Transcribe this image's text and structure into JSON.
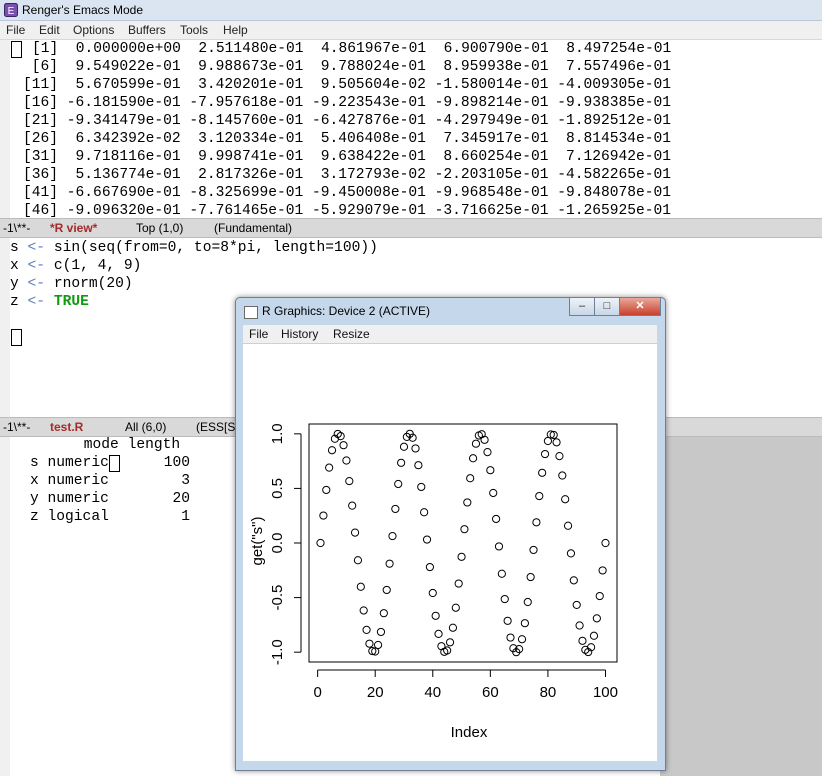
{
  "emacs": {
    "title": "Renger's Emacs Mode",
    "menu": [
      "File",
      "Edit",
      "Options",
      "Buffers",
      "Tools",
      "Help"
    ]
  },
  "output_lines": [
    "[1]  0.000000e+00  2.511480e-01  4.861967e-01  6.900790e-01  8.497254e-01",
    " [6]  9.549022e-01  9.988673e-01  9.788024e-01  8.959938e-01  7.557496e-01",
    "[11]  5.670599e-01  3.420201e-01  9.505604e-02 -1.580014e-01 -4.009305e-01",
    "[16] -6.181590e-01 -7.957618e-01 -9.223543e-01 -9.898214e-01 -9.938385e-01",
    "[21] -9.341479e-01 -8.145760e-01 -6.427876e-01 -4.297949e-01 -1.892512e-01",
    "[26]  6.342392e-02  3.120334e-01  5.406408e-01  7.345917e-01  8.814534e-01",
    "[31]  9.718116e-01  9.998741e-01  9.638422e-01  8.660254e-01  7.126942e-01",
    "[36]  5.136774e-01  2.817326e-01  3.172793e-02 -2.203105e-01 -4.582265e-01",
    "[41] -6.667690e-01 -8.325699e-01 -9.450008e-01 -9.968548e-01 -9.848078e-01",
    "[46] -9.096320e-01 -7.761465e-01 -5.929079e-01 -3.716625e-01 -1.265925e-01"
  ],
  "modeline_rview": {
    "status": "-1\\**-",
    "buffer": "*R view*",
    "position": "Top (1,0)",
    "mode": "(Fundamental)"
  },
  "rview_lines": [
    {
      "var": "s",
      "arrow": "<-",
      "rest": "sin(seq(from=0, to=8*pi, length=100))"
    },
    {
      "var": "x",
      "arrow": "<-",
      "rest": "c(1, 4, 9)"
    },
    {
      "var": "y",
      "arrow": "<-",
      "rest": "rnorm(20)"
    },
    {
      "var": "z",
      "arrow": "<-",
      "rest": "TRUE"
    }
  ],
  "modeline_test": {
    "status": "-1\\**-",
    "buffer": "test.R",
    "position": "All (6,0)",
    "mode": "(ESS[S"
  },
  "table": {
    "header": "     mode length",
    "rows": [
      {
        "name": "s",
        "mode": "numeric",
        "length": "100"
      },
      {
        "name": "x",
        "mode": "numeric",
        "length": "3"
      },
      {
        "name": "y",
        "mode": "numeric",
        "length": "20"
      },
      {
        "name": "z",
        "mode": "logical",
        "length": "1"
      }
    ]
  },
  "rgraphics": {
    "title": "R Graphics: Device 2 (ACTIVE)",
    "menu": [
      "File",
      "History",
      "Resize"
    ],
    "buttons": {
      "minimize": "–",
      "maximize": "□",
      "close": "✕"
    }
  },
  "chart_data": {
    "type": "scatter",
    "xlabel": "Index",
    "ylabel": "get(\"s\")",
    "xlim": [
      0,
      100
    ],
    "ylim": [
      -1.0,
      1.0
    ],
    "xticks": [
      0,
      20,
      40,
      60,
      80,
      100
    ],
    "yticks": [
      -1.0,
      -0.5,
      0.0,
      0.5,
      1.0
    ],
    "ytick_labels": [
      "-1.0",
      "-0.5",
      "0.0",
      "0.5",
      "1.0"
    ],
    "x": [
      1,
      2,
      3,
      4,
      5,
      6,
      7,
      8,
      9,
      10,
      11,
      12,
      13,
      14,
      15,
      16,
      17,
      18,
      19,
      20,
      21,
      22,
      23,
      24,
      25,
      26,
      27,
      28,
      29,
      30,
      31,
      32,
      33,
      34,
      35,
      36,
      37,
      38,
      39,
      40,
      41,
      42,
      43,
      44,
      45,
      46,
      47,
      48,
      49,
      50,
      51,
      52,
      53,
      54,
      55,
      56,
      57,
      58,
      59,
      60,
      61,
      62,
      63,
      64,
      65,
      66,
      67,
      68,
      69,
      70,
      71,
      72,
      73,
      74,
      75,
      76,
      77,
      78,
      79,
      80,
      81,
      82,
      83,
      84,
      85,
      86,
      87,
      88,
      89,
      90,
      91,
      92,
      93,
      94,
      95,
      96,
      97,
      98,
      99,
      100
    ],
    "y": [
      0.0,
      0.2511,
      0.4862,
      0.6901,
      0.8497,
      0.9549,
      0.9989,
      0.9788,
      0.896,
      0.7557,
      0.5671,
      0.342,
      0.0951,
      -0.158,
      -0.4009,
      -0.6182,
      -0.7958,
      -0.9224,
      -0.9898,
      -0.9938,
      -0.9341,
      -0.8146,
      -0.6428,
      -0.4298,
      -0.1893,
      0.0634,
      0.312,
      0.5406,
      0.7346,
      0.8815,
      0.9718,
      0.9999,
      0.9638,
      0.866,
      0.7127,
      0.5137,
      0.2817,
      0.0317,
      -0.2203,
      -0.4582,
      -0.6668,
      -0.8326,
      -0.945,
      -0.9969,
      -0.9848,
      -0.9096,
      -0.7761,
      -0.5929,
      -0.3717,
      -0.1266,
      0.1266,
      0.3717,
      0.5929,
      0.7761,
      0.9096,
      0.9848,
      0.9969,
      0.945,
      0.8326,
      0.6668,
      0.4582,
      0.2203,
      -0.0317,
      -0.2817,
      -0.5137,
      -0.7127,
      -0.866,
      -0.9638,
      -0.9999,
      -0.9718,
      -0.8815,
      -0.7346,
      -0.5406,
      -0.312,
      -0.0634,
      0.1893,
      0.4298,
      0.6428,
      0.8146,
      0.9341,
      0.9938,
      0.9898,
      0.9224,
      0.7958,
      0.6182,
      0.4009,
      0.158,
      -0.0951,
      -0.342,
      -0.5671,
      -0.7557,
      -0.896,
      -0.9788,
      -0.9989,
      -0.9549,
      -0.8497,
      -0.6901,
      -0.4862,
      -0.2511,
      0.0
    ]
  }
}
